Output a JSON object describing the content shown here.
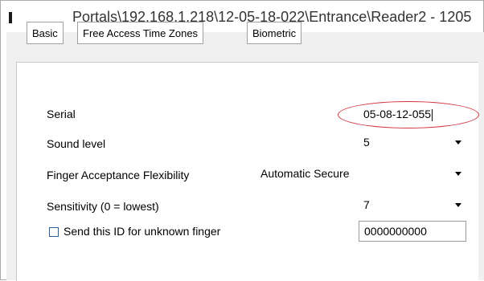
{
  "window": {
    "title": "Portals\\192.168.1.218\\12-05-18-022\\Entrance\\Reader2 - 1205"
  },
  "tabs": [
    {
      "label": "Basic"
    },
    {
      "label": "Free Access Time Zones"
    },
    {
      "label": "Biometric"
    }
  ],
  "fields": {
    "serial": {
      "label": "Serial",
      "value": "05-08-12-055"
    },
    "sound_level": {
      "label": "Sound level",
      "value": "5"
    },
    "finger_flexibility": {
      "label": "Finger Acceptance Flexibility",
      "value": "Automatic Secure"
    },
    "sensitivity": {
      "label": "Sensitivity (0 = lowest)",
      "value": "7"
    },
    "unknown_finger": {
      "label": "Send this ID for unknown finger",
      "value": "0000000000",
      "checked": false
    }
  },
  "colors": {
    "highlight": "#d0303a",
    "checkbox_border": "#2a5d9a"
  }
}
